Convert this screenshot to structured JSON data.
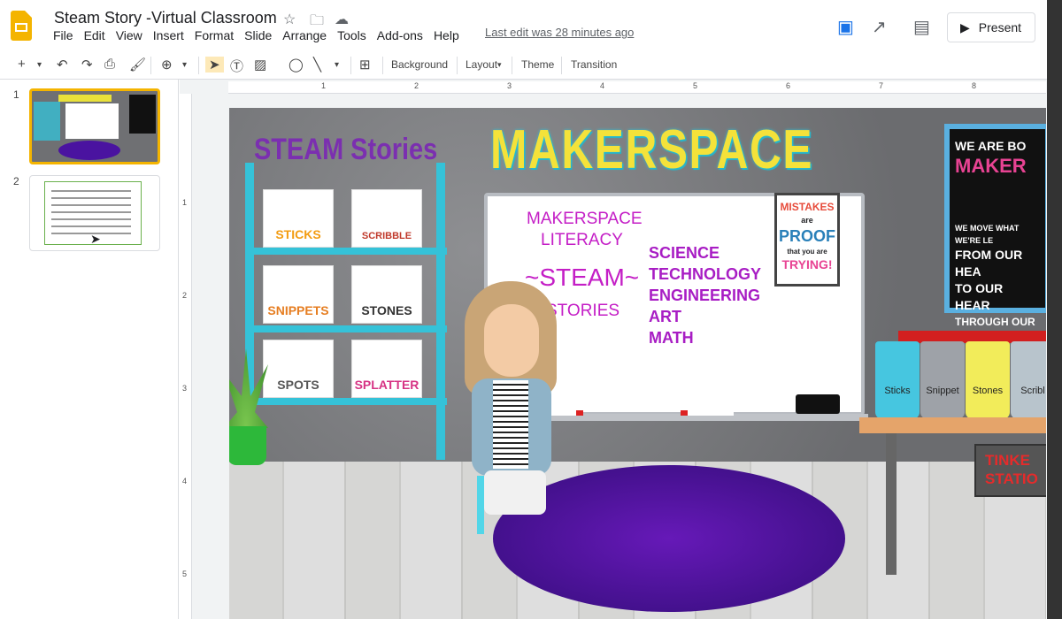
{
  "app": {
    "doc_title": "Steam Story -Virtual Classroom",
    "menu": [
      "File",
      "Edit",
      "View",
      "Insert",
      "Format",
      "Slide",
      "Arrange",
      "Tools",
      "Add-ons",
      "Help"
    ],
    "last_edit": "Last edit was 28 minutes ago",
    "present_label": "Present"
  },
  "toolbar": {
    "background_label": "Background",
    "layout_label": "Layout",
    "theme_label": "Theme",
    "transition_label": "Transition"
  },
  "ruler": {
    "h_ticks": [
      "1",
      "1",
      "2",
      "3",
      "4",
      "5",
      "6",
      "7",
      "8"
    ],
    "v_ticks": [
      "1",
      "2",
      "3",
      "4",
      "5"
    ]
  },
  "filmstrip": {
    "slides": [
      {
        "number": "1",
        "selected": true
      },
      {
        "number": "2",
        "selected": false
      }
    ]
  },
  "slide": {
    "steam_heading": "STEAM Stories",
    "makerspace_title": "MAKERSPACE",
    "books": [
      "STICKS",
      "SCRIBBLE",
      "SNIPPETS",
      "STONES",
      "SPOTS",
      "SPLATTER"
    ],
    "whiteboard": {
      "line1": "MAKERSPACE",
      "line2": "LITERACY",
      "steam": "~STEAM~",
      "stories": "STORIES",
      "list": [
        "SCIENCE",
        "TECHNOLOGY",
        "ENGINEERING",
        "ART",
        "MATH"
      ]
    },
    "mistakes_poster": [
      "MISTAKES",
      "are",
      "PROOF",
      "that you are",
      "TRYING!"
    ],
    "right_poster": [
      "WE ARE BO",
      "MAKER",
      "WE MOVE WHAT WE'RE LE",
      "FROM OUR HEA",
      "TO OUR HEAR",
      "THROUGH OUR HA"
    ],
    "bins": [
      "Sticks",
      "Snippet",
      "Stones",
      "Scribl"
    ],
    "tinker_sign": [
      "TINKE",
      "STATIO"
    ]
  },
  "colors": {
    "accent_yellow": "#f4b400",
    "makerspace_yellow": "#f4e23a",
    "steam_purple": "#7b2fb0",
    "whiteboard_magenta": "#c41ec6",
    "shelf_cyan": "#35c2d8",
    "rug_purple": "#5a17a8"
  }
}
